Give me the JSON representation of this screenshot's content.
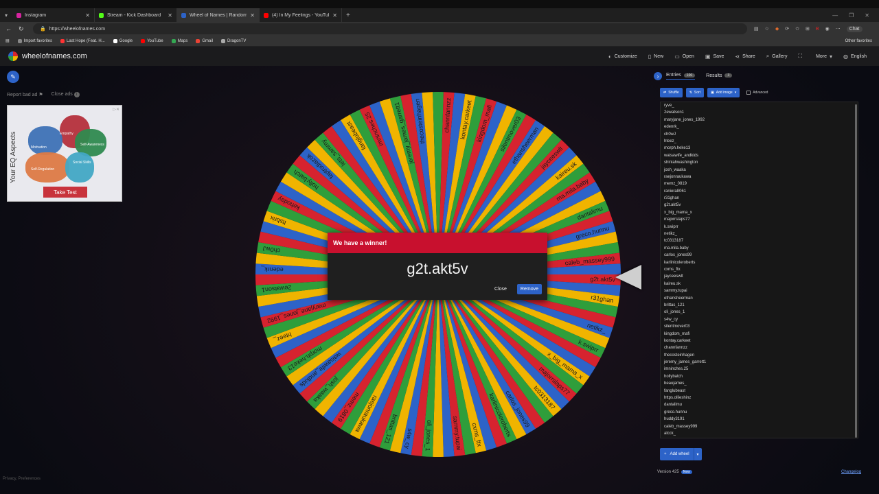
{
  "browser": {
    "tabs": [
      {
        "label": "Instagram",
        "color": "#d6249f",
        "active": false
      },
      {
        "label": "Stream - Kick Dashboard",
        "color": "#53fc18",
        "active": false
      },
      {
        "label": "Wheel of Names | Random name ...",
        "color": "#2d63c8",
        "active": true
      },
      {
        "label": "(4) In My Feelings - YouTube",
        "color": "#ff0000",
        "active": false
      }
    ],
    "url": "https://wheelofnames.com",
    "bookmarks": [
      {
        "label": "Import favorites",
        "color": "#888888"
      },
      {
        "label": "Last Hope (Feat. H...",
        "color": "#ff3333"
      },
      {
        "label": "Google",
        "color": "#ffffff"
      },
      {
        "label": "YouTube",
        "color": "#ff0000"
      },
      {
        "label": "Maps",
        "color": "#34a853"
      },
      {
        "label": "Gmail",
        "color": "#ea4335"
      },
      {
        "label": "DragonTV",
        "color": "#aaaaaa"
      }
    ],
    "other_favorites": "Other favorites",
    "chat": "Chat"
  },
  "site": {
    "name": "wheelofnames.com",
    "menu": [
      {
        "label": "Customize",
        "icon": "palette-icon"
      },
      {
        "label": "New",
        "icon": "new-file-icon"
      },
      {
        "label": "Open",
        "icon": "folder-icon"
      },
      {
        "label": "Save",
        "icon": "save-icon"
      },
      {
        "label": "Share",
        "icon": "share-icon"
      },
      {
        "label": "Gallery",
        "icon": "search-icon"
      },
      {
        "label": "",
        "icon": "fullscreen-icon"
      },
      {
        "label": "More",
        "icon": "chevron-down-icon"
      },
      {
        "label": "English",
        "icon": "globe-icon"
      }
    ]
  },
  "ad": {
    "report": "Report bad ad",
    "close": "Close ads",
    "title": "Your EQ Aspects",
    "labels": [
      "Empathy",
      "Motivation",
      "Self-Awareness",
      "Self-Regulation",
      "Social Skills"
    ],
    "button": "Take Test"
  },
  "wheel": {
    "colors": [
      "#d6232f",
      "#2d63c8",
      "#f0b400",
      "#2f9e3b"
    ],
    "visible_labels": [
      "g2t.akt5v",
      "r31ghan",
      "netikz_",
      "k.swiprr",
      "x_big_mama_x",
      "majorrslaps77",
      "tc0313187",
      "carlos_jones99",
      "karlinicoleroberts",
      "cxms_ftx",
      "sammy.tupai",
      "oli_jones_1",
      "s4w_cy",
      "brittas_121",
      "raejonraukawa",
      "memz_0819",
      "josh_waaka",
      "waisawife_andkids",
      "morph.heke13",
      "hteez_",
      "maryjane_jones_1992",
      "2ewatson1",
      "edenrk_",
      "ch0wJ",
      "Itsbrix",
      "kehoday",
      "holly.batch",
      "faptrodiazok",
      "lets_sammy",
      "fanglubeast",
      "imninches.25",
      "jeremy_james_garrett1",
      "thecosteinhagen",
      "channfannzz",
      "kontay.carkeet",
      "kingdom_mafi",
      "silentmover03",
      "ethansheerman",
      "jayceeswlt",
      "kaireu.sk",
      "ma.mila.baby",
      "dantalimu",
      "greco.hunnu",
      "caleb_massey999"
    ]
  },
  "dialog": {
    "heading": "We have a winner!",
    "winner": "g2t.akt5v",
    "close": "Close",
    "remove": "Remove"
  },
  "panel": {
    "entries_tab": "Entries",
    "entries_count": "106",
    "results_tab": "Results",
    "results_count": "3",
    "shuffle": "Shuffle",
    "sort": "Sort",
    "add_image": "Add image",
    "advanced": "Advanced",
    "entries": [
      "ryve_",
      "2ewatson1",
      "maryjane_jones_1992",
      "edenrk_",
      "ch0wJ",
      "hteez_",
      "morph.heke13",
      "waisawife_andkids",
      "shinlahwashington",
      "josh_waaka",
      "raejonraukawa",
      "memz_0819",
      "raniera8061",
      "r31ghan",
      "g2t.akt5v",
      "x_big_mama_x",
      "majorrslaps77",
      "k.swiprr",
      "netikz_",
      "tc0313187",
      "ma.mila.baby",
      "carlos_jones99",
      "karlinicoleroberts",
      "cxms_ftx",
      "jayceeswlt",
      "kaireu.sk",
      "sammy.tupai",
      "ethansheerman",
      "brittas_121",
      "oli_jones_1",
      "s4w_cy",
      "silentmover03",
      "kingdom_mafi",
      "kontay.carkeet",
      "channfannzz",
      "thecosteinhagen",
      "jeremy_james_garrett1",
      "imninches.25",
      "hollybatch",
      "beaujames_",
      "fanglubeast",
      "https.ollieshinz",
      "dantalimu",
      "greco.hunnu",
      "huddy3191",
      "caleb_massey999",
      "alcck_"
    ],
    "add_wheel": "Add wheel",
    "version": "Version 425",
    "new_badge": "New",
    "changelog": "Changelog"
  },
  "footer": {
    "privacy": "Privacy, Preferences"
  }
}
